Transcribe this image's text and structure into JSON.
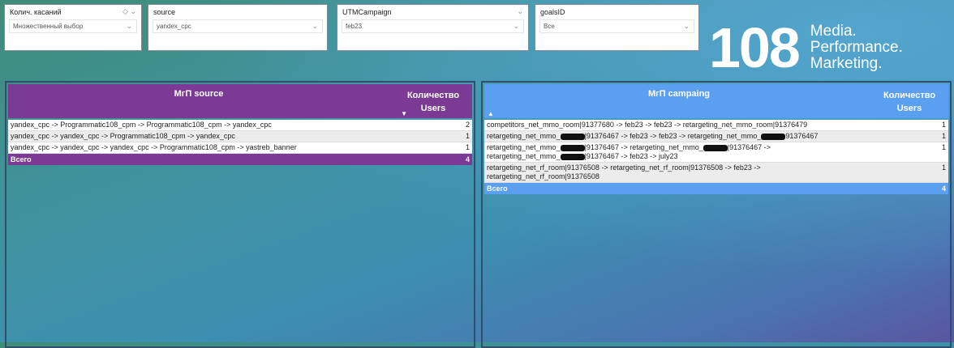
{
  "slicers": [
    {
      "title": "Колич. касаний",
      "value": "Множественный выбор"
    },
    {
      "title": "source",
      "value": "yandex_cpc"
    },
    {
      "title": "UTMCampaign",
      "value": "feb23"
    },
    {
      "title": "goalsID",
      "value": "Все"
    }
  ],
  "logo": {
    "number": "108",
    "line1": "Media.",
    "line2": "Performance.",
    "line3": "Marketing."
  },
  "left_table": {
    "header": "МгП source",
    "count_header_1": "Количество",
    "count_header_2": "Users",
    "color": "#7b3a94",
    "rows": [
      {
        "path": "yandex_cpc -> Programmatic108_cpm -> Programmatic108_cpm -> yandex_cpc",
        "count": "2"
      },
      {
        "path": "yandex_cpc -> yandex_cpc -> Programmatic108_cpm -> yandex_cpc",
        "count": "1"
      },
      {
        "path": "yandex_cpc -> yandex_cpc -> yandex_cpc -> Programmatic108_cpm -> yastreb_banner",
        "count": "1"
      }
    ],
    "total_label": "Всего",
    "total": "4"
  },
  "right_table": {
    "header": "МгП campaing",
    "count_header_1": "Количество",
    "count_header_2": "Users",
    "color": "#5b9ff0",
    "rows": [
      {
        "parts": [
          "competitors_net_mmo_room|91377680 -> feb23 -> feb23 -> retargeting_net_mmo_room|91376479"
        ],
        "count": "1"
      },
      {
        "parts": [
          "retargeting_net_mmo_",
          "|91376467 -> feb23 -> feb23 -> retargeting_net_mmo_",
          "91376467"
        ],
        "count": "1"
      },
      {
        "parts": [
          "retargeting_net_mmo_",
          "|91376467 -> retargeting_net_mmo_",
          "|91376467 ->",
          "retargeting_net_mmo_",
          "|91376467 -> feb23 -> july23"
        ],
        "count": "1"
      },
      {
        "parts": [
          "retargeting_net_rf_room|91376508 -> retargeting_net_rf_room|91376508 -> feb23 ->",
          "retargeting_net_rf_room|91376508"
        ],
        "count": "1"
      }
    ],
    "total_label": "Всего",
    "total": "4"
  }
}
